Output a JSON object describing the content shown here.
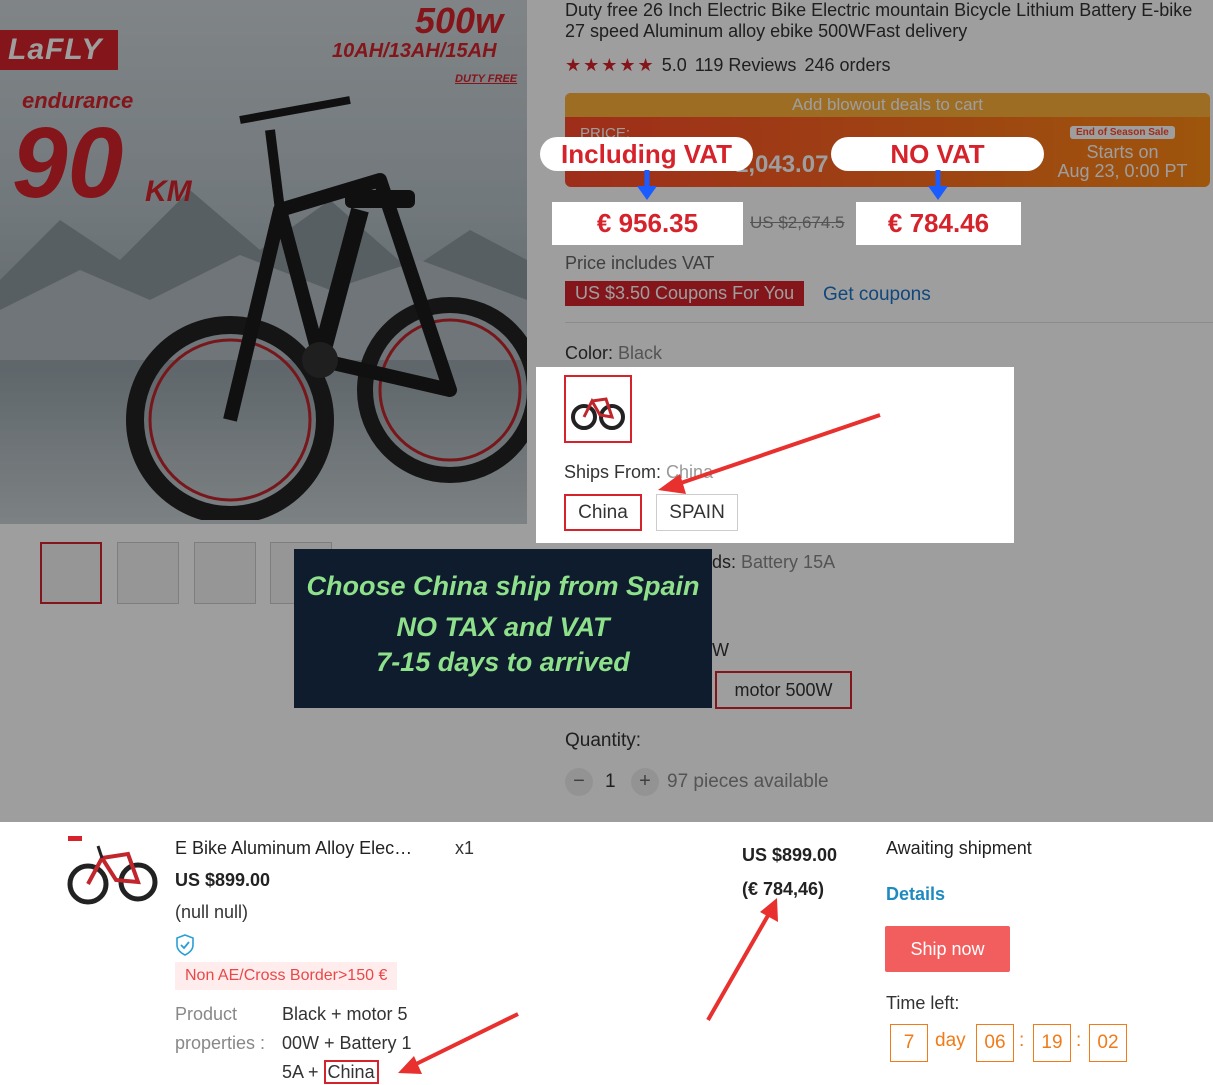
{
  "banner": {
    "brand": "LaFLY",
    "power": "500w",
    "battery_options": "10AH/13AH/15AH",
    "duty_free": "DUTY FREE",
    "endurance_label": "endurance",
    "endurance_value": "90",
    "endurance_unit": "KM"
  },
  "product": {
    "title": "Duty free 26 Inch Electric Bike Electric mountain Bicycle Lithium Battery E-bike 27 speed Aluminum alloy ebike 500WFast delivery",
    "stars": "★★★★★",
    "rating": "5.0",
    "reviews": "119 Reviews",
    "orders": "246 orders",
    "deal": {
      "header": "Add blowout deals to cart",
      "price_label": "PRICE:",
      "price": "1,043.07",
      "badge": "End of Season Sale",
      "starts_line1": "Starts on",
      "starts_line2": "Aug 23, 0:00 PT"
    },
    "old_price": "US $2,674.5",
    "vat_note": "Price includes VAT",
    "coupon": "US $3.50 Coupons For You",
    "get_coupons": "Get coupons",
    "color_label": "Color:",
    "color_value": "Black",
    "ships_from_label": "Ships From:",
    "ships_from_value": "China",
    "ships_options": [
      "China",
      "SPAIN"
    ],
    "bundle_label": "ds:",
    "bundle_value": "Battery 15A",
    "motor_option": "motor 500W",
    "motor_partial": "W",
    "quantity_label": "Quantity:",
    "quantity_value": "1",
    "pieces_available": "97 pieces available"
  },
  "annotations": {
    "including_vat_label": "Including VAT",
    "including_vat_price": "€ 956.35",
    "no_vat_label": "NO VAT",
    "no_vat_price": "€ 784.46",
    "note_line1": "Choose China ship from Spain",
    "note_line2": "NO TAX and VAT",
    "note_line3": "7-15 days to arrived"
  },
  "order": {
    "title": "E Bike Aluminum Alloy Elec…",
    "qty": "x1",
    "price": "US $899.00",
    "null_text": "(null null)",
    "tag": "Non AE/Cross Border>150 €",
    "properties_label_1": "Product",
    "properties_label_2": "properties :",
    "properties_line1": "Black + motor 5",
    "properties_line2": "00W + Battery 1",
    "properties_line3_prefix": "5A + ",
    "properties_line3_box": "China",
    "total_usd": "US $899.00",
    "total_eur": "(€ 784,46)",
    "status": "Awaiting shipment",
    "details": "Details",
    "ship_now": "Ship now",
    "time_left_label": "Time left:",
    "timer_days": "7",
    "timer_day_label": "day",
    "timer_hours": "06",
    "timer_minutes": "19",
    "timer_seconds": "02"
  },
  "colors": {
    "accent_red": "#d6232b",
    "note_bg": "#0f1c2e",
    "note_text": "#8fe08a",
    "timer_orange": "#f07b18",
    "ship_button": "#f25d5d",
    "details_link": "#1f8ac0"
  }
}
